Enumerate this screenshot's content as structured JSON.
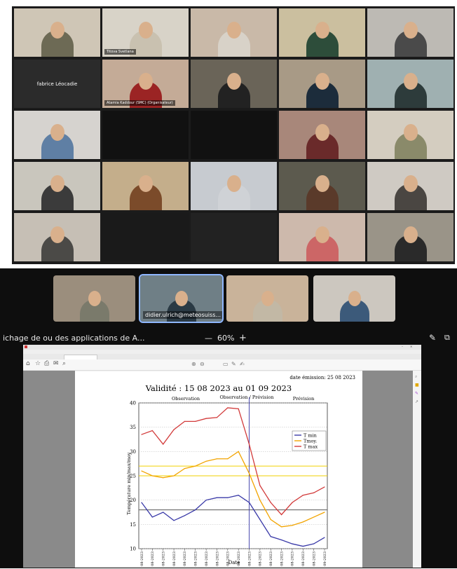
{
  "grid": {
    "tiles": [
      {
        "name": "",
        "bg": "#cfc6b6",
        "shirt": "#6d6a55"
      },
      {
        "name": "Titova Svetlana",
        "bg": "#d8d3c8",
        "shirt": "#c9c1b0"
      },
      {
        "name": "",
        "bg": "#c9b9a8",
        "shirt": "#d8d2c8"
      },
      {
        "name": "",
        "bg": "#cbbf9f",
        "shirt": "#2d4d3a"
      },
      {
        "name": "",
        "bg": "#bdbab4",
        "shirt": "#4a4a4a"
      },
      {
        "name": "",
        "label": "fabrice Léocadie",
        "bg": "#2b2b2b",
        "shirt": ""
      },
      {
        "name": "Atamia Kaddour (SMC) (Organisateur)",
        "bg": "#c4ab97",
        "shirt": "#9b2424"
      },
      {
        "name": "",
        "bg": "#6a6458",
        "shirt": "#222"
      },
      {
        "name": "",
        "bg": "#a89a86",
        "shirt": "#1c2c3b"
      },
      {
        "name": "",
        "bg": "#9fb0b1",
        "shirt": "#2d3b3b"
      },
      {
        "name": "",
        "bg": "#d6d3cf",
        "shirt": "#5f7fa4"
      },
      {
        "name": "",
        "bg": "#111",
        "shirt": ""
      },
      {
        "name": "",
        "bg": "#111",
        "shirt": ""
      },
      {
        "name": "",
        "bg": "#a8877a",
        "shirt": "#6a2a2a"
      },
      {
        "name": "",
        "bg": "#d4cdc0",
        "shirt": "#8a8a6a"
      },
      {
        "name": "",
        "bg": "#c9c6bd",
        "shirt": "#3b3b3b"
      },
      {
        "name": "",
        "bg": "#c4ae8b",
        "shirt": "#7b4b2a"
      },
      {
        "name": "",
        "bg": "#c7cbd0",
        "shirt": "#cfd2d6"
      },
      {
        "name": "",
        "bg": "#5c5a4e",
        "shirt": "#5a3a2a"
      },
      {
        "name": "",
        "bg": "#cfcac3",
        "shirt": "#4a4642"
      },
      {
        "name": "",
        "bg": "#c6bfb5",
        "shirt": "#4b4a47"
      },
      {
        "name": "",
        "bg": "#1a1a1a",
        "shirt": ""
      },
      {
        "name": "",
        "bg": "#222",
        "shirt": ""
      },
      {
        "name": "",
        "bg": "#cdb9ac",
        "shirt": "#c66"
      },
      {
        "name": "",
        "bg": "#9a9488",
        "shirt": "#2a2a2a"
      }
    ]
  },
  "meeting": {
    "thumbs": [
      {
        "name": "",
        "bg": "#9b8e7d",
        "shirt": "#7a7a6b"
      },
      {
        "name": "didier.ulrich@meteosuiss...",
        "bg": "#6f7f86",
        "shirt": "#2a3a44"
      },
      {
        "name": "",
        "bg": "#c9b39a",
        "shirt": "#c2b8a5"
      },
      {
        "name": "",
        "bg": "#ccc7bf",
        "shirt": "#3c5a7a"
      }
    ],
    "share_title": "ichage de ou des applications de A...",
    "zoom_minus": "—",
    "zoom_level": "60%",
    "zoom_plus": "+"
  },
  "pdf": {
    "emission": "date émission: 25 08 2023",
    "title": "Validité : 15 08 2023 au 01 09 2023",
    "period_labels": [
      "Observation",
      "Observation / Prévision",
      "Prévision"
    ],
    "ylabel": "Température min/max/moy",
    "xlabel": "Date"
  },
  "chart_data": {
    "type": "line",
    "title": "Validité : 15 08 2023 au 01 09 2023",
    "xlabel": "Date",
    "ylabel": "Température min/max/moy",
    "x": [
      "15-08-2023",
      "16-08-2023",
      "17-08-2023",
      "18-08-2023",
      "19-08-2023",
      "20-08-2023",
      "21-08-2023",
      "22-08-2023",
      "23-08-2023",
      "24-08-2023",
      "25-08-2023",
      "26-08-2023",
      "27-08-2023",
      "28-08-2023",
      "29-08-2023",
      "30-08-2023",
      "31-08-2023",
      "01-09-2023"
    ],
    "ylim": [
      10,
      40
    ],
    "yticks": [
      10,
      15,
      20,
      25,
      30,
      35,
      40
    ],
    "grid": true,
    "legend_position": "right",
    "series": [
      {
        "name": "T min",
        "color": "#3a3aa8",
        "values": [
          19.5,
          16.5,
          17.5,
          15.8,
          16.8,
          18,
          20,
          20.5,
          20.5,
          21,
          19.5,
          16,
          12.5,
          11.8,
          11,
          10.5,
          11,
          12.3
        ]
      },
      {
        "name": "Tmoy.",
        "color": "#f2a400",
        "values": [
          26,
          25,
          24.6,
          25,
          26.5,
          27,
          28,
          28.5,
          28.5,
          30,
          25.5,
          20,
          16,
          14.5,
          14.8,
          15.5,
          16.5,
          17.5
        ]
      },
      {
        "name": "T max",
        "color": "#d23a3a",
        "values": [
          33.5,
          34.3,
          31.5,
          34.5,
          36.2,
          36.2,
          36.8,
          37,
          39,
          38.8,
          31.5,
          23,
          19.5,
          17,
          19.5,
          21,
          21.5,
          22.7
        ]
      }
    ],
    "reference_lines": [
      {
        "color": "#f2d200",
        "values": [
          25,
          27
        ]
      },
      {
        "color": "#6a6a6a",
        "values": [
          18
        ]
      }
    ],
    "today_marker": "25-08-2023"
  }
}
